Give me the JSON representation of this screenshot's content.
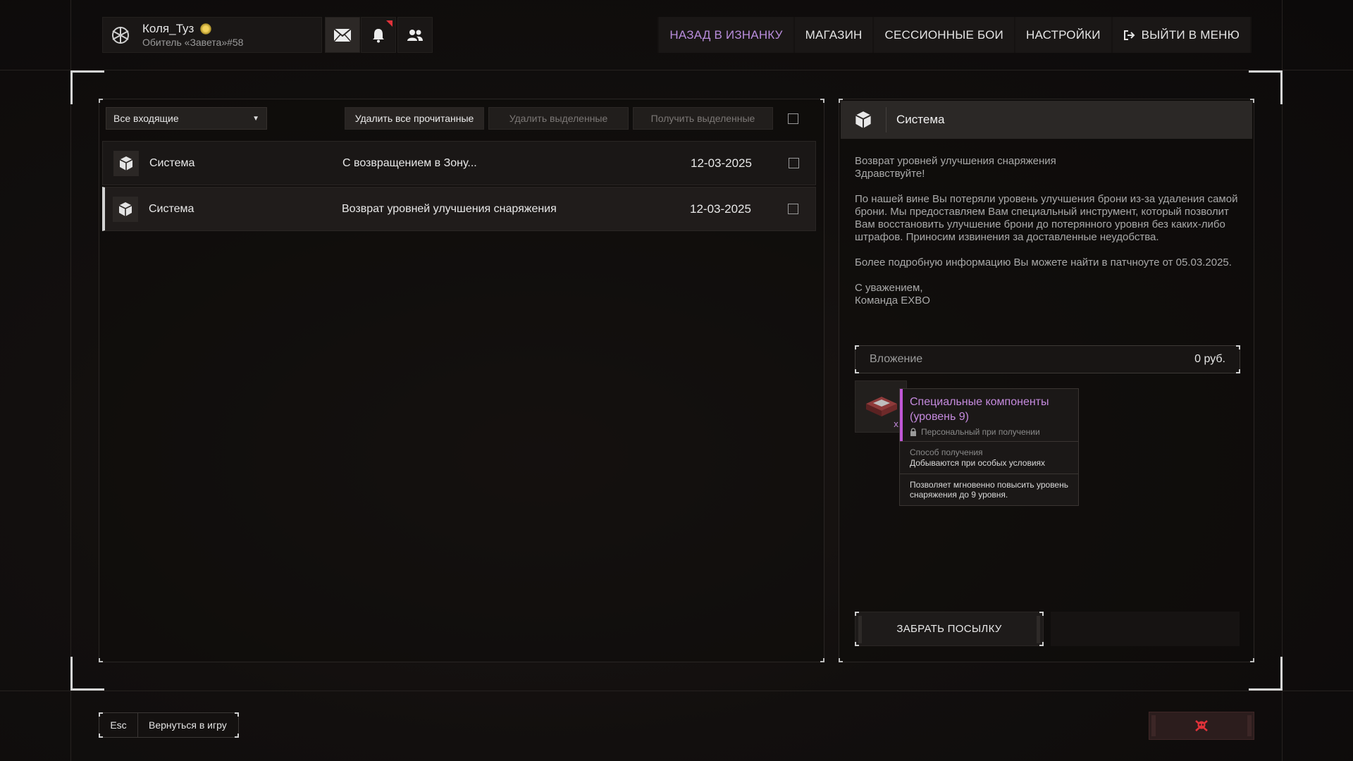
{
  "profile": {
    "name": "Коля_Туз",
    "group": "Обитель «Завета»#58"
  },
  "header_icons": [
    "mail-icon",
    "bell-icon",
    "friends-icon"
  ],
  "nav": {
    "items": [
      {
        "label": "НАЗАД В ИЗНАНКУ",
        "accent": true
      },
      {
        "label": "МАГАЗИН"
      },
      {
        "label": "СЕССИОННЫЕ БОИ"
      },
      {
        "label": "НАСТРОЙКИ"
      },
      {
        "label": "ВЫЙТИ В МЕНЮ",
        "icon": "exit-icon"
      }
    ]
  },
  "toolbar": {
    "filter_value": "Все входящие",
    "delete_read": "Удалить все прочитанные",
    "delete_selected": "Удалить выделенные",
    "get_selected": "Получить выделенные"
  },
  "mail_list": [
    {
      "sender": "Система",
      "subject": "С возвращением в Зону...",
      "date": "12-03-2025",
      "selected": false
    },
    {
      "sender": "Система",
      "subject": "Возврат уровней улучшения снаряжения",
      "date": "12-03-2025",
      "selected": true
    }
  ],
  "message": {
    "sender": "Система",
    "subject_line": "Возврат уровней улучшения снаряжения",
    "greeting": "Здравствуйте!",
    "paragraph1": "По нашей вине Вы потеряли уровень улучшения брони из-за удаления самой брони. Мы предоставляем Вам специальный инструмент, который позволит Вам восстановить улучшение брони до потерянного уровня без каких-либо штрафов. Приносим извинения за доставленные неудобства.",
    "paragraph2": "Более подробную информацию Вы можете найти в патчноуте от 05.03.2025.",
    "sign1": "С уважением,",
    "sign2": "Команда EXBO"
  },
  "attachment": {
    "label": "Вложение",
    "price": "0 руб.",
    "item": {
      "quantity": "x1",
      "name": "Специальные компоненты (уровень 9)",
      "personal": "Персональный при получении",
      "obtain_label": "Способ получения",
      "obtain_value": "Добываются при особых условиях",
      "description": "Позволяет мгновенно повысить уровень снаряжения до 9 уровня.",
      "rarity_color": "#c057d6"
    }
  },
  "take_button": "ЗАБРАТЬ ПОСЫЛКУ",
  "footer": {
    "key": "Esc",
    "label": "Вернуться в игру"
  },
  "colors": {
    "accent": "#b98ddc",
    "danger": "#e0323a"
  }
}
